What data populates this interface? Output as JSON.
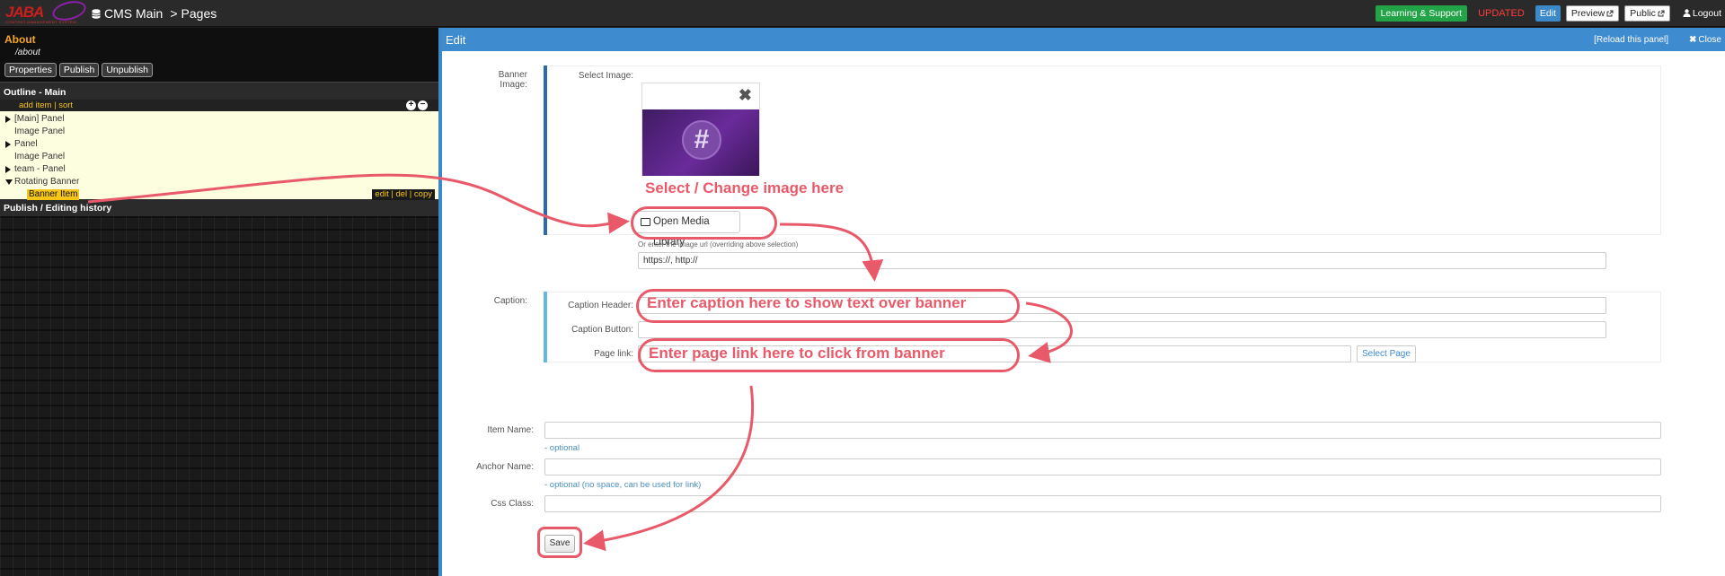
{
  "topbar": {
    "logo_text": "JABA",
    "logo_sub": "CONTENT MANAGEMENT SYSTEM",
    "app_name": "CMS Main",
    "crumb_sep": ">",
    "crumb_page": "Pages",
    "learning_label": "Learning & Support",
    "status": "UPDATED",
    "edit_label": "Edit",
    "preview_label": "Preview",
    "public_label": "Public",
    "logout_label": "Logout"
  },
  "page": {
    "title": "About",
    "path": "/about",
    "buttons": [
      "Properties",
      "Publish",
      "Unpublish"
    ]
  },
  "outline": {
    "heading": "Outline - Main",
    "add_item": "add item",
    "sort": "sort",
    "items": [
      {
        "label": "[Main] Panel",
        "expand": "right"
      },
      {
        "label": "Image Panel",
        "expand": "none"
      },
      {
        "label": "Panel",
        "expand": "right"
      },
      {
        "label": "Image Panel",
        "expand": "none"
      },
      {
        "label": "team - Panel",
        "expand": "right"
      },
      {
        "label": "Rotating Banner",
        "expand": "down"
      },
      {
        "label": "Banner Item",
        "expand": "none",
        "selected": true
      }
    ],
    "row_actions": [
      "edit",
      "del",
      "copy"
    ]
  },
  "history": {
    "heading": "Publish / Editing history"
  },
  "edit": {
    "title": "Edit",
    "reload": "[Reload this panel]",
    "close": "Close",
    "banner_label": "Banner Image:",
    "select_image_label": "Select Image:",
    "open_media": "Open Media Library",
    "url_note": "Or enter the image url (overriding above selection)",
    "url_value": "https://, http://",
    "caption_label": "Caption:",
    "caption_header_label": "Caption Header:",
    "caption_button_label": "Caption Button:",
    "page_link_label": "Page link:",
    "select_page": "Select Page",
    "item_name_label": "Item Name:",
    "item_name_help": "- optional",
    "anchor_name_label": "Anchor Name:",
    "anchor_name_help": "- optional (no space, can be used for link)",
    "css_class_label": "Css Class:",
    "save": "Save"
  },
  "annotations": {
    "select_image": "Select / Change image here",
    "caption": "Enter caption here to show text over banner",
    "page_link": "Enter page link here to click from banner",
    "color": "#e85a6a"
  }
}
